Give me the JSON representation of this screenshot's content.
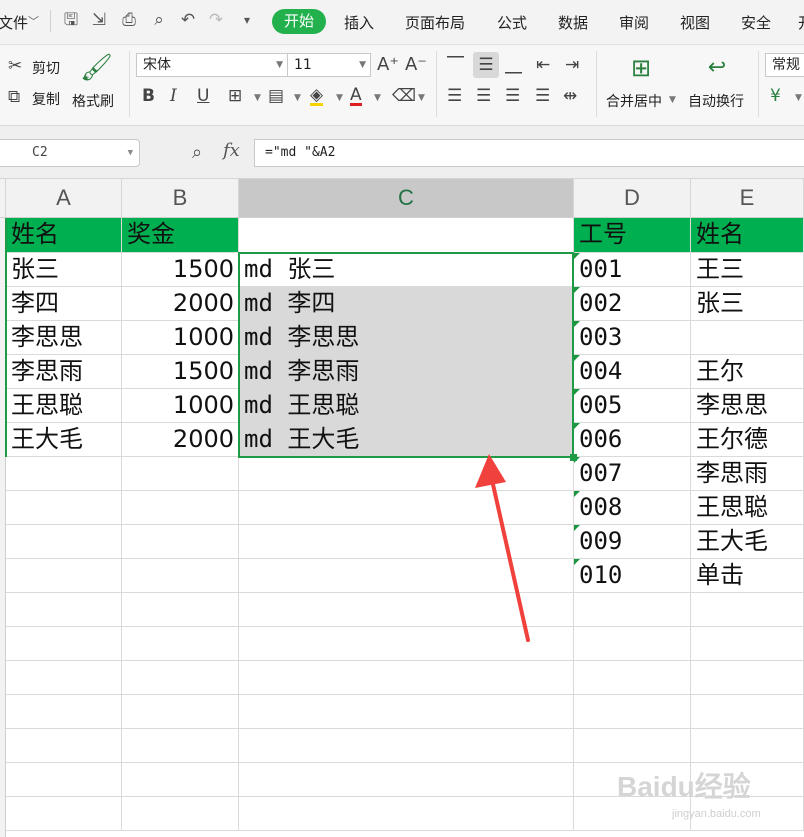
{
  "menu": {
    "file": "文件",
    "tabs": [
      "开始",
      "插入",
      "页面布局",
      "公式",
      "数据",
      "审阅",
      "视图",
      "安全",
      "开"
    ]
  },
  "ribbon": {
    "cut": "剪切",
    "copy": "复制",
    "format_painter": "格式刷",
    "font_name": "宋体",
    "font_size": "11",
    "merge_center": "合并居中",
    "wrap_text": "自动换行",
    "number_format": "常规"
  },
  "formula_bar": {
    "cell_ref": "C2",
    "fx": "fx",
    "formula": "=\"md \"&A2"
  },
  "grid": {
    "columns": [
      "A",
      "B",
      "C",
      "D",
      "E"
    ],
    "selected_column": "C",
    "header_row": [
      "姓名",
      "奖金",
      "",
      "工号",
      "姓名"
    ],
    "col_a": [
      "张三",
      "李四",
      "李思思",
      "李思雨",
      "王思聪",
      "王大毛"
    ],
    "col_b": [
      "1500",
      "2000",
      "1000",
      "1500",
      "1000",
      "2000"
    ],
    "col_c": [
      "md 张三",
      "md 李四",
      "md 李思思",
      "md 李思雨",
      "md 王思聪",
      "md 王大毛"
    ],
    "col_d": [
      "001",
      "002",
      "003",
      "004",
      "005",
      "006",
      "007",
      "008",
      "009",
      "010"
    ],
    "col_e": [
      "王三",
      "张三",
      "",
      "王尔",
      "李思思",
      "王尔德",
      "李思雨",
      "王思聪",
      "王大毛",
      "单击"
    ]
  },
  "colors": {
    "accent": "#22b14c",
    "header_fill": "#00b050",
    "selection_fill": "#d9d9d9",
    "arrow": "#f0413c"
  },
  "watermark": {
    "brand": "Baidu经验",
    "url": "jingyan.baidu.com"
  }
}
